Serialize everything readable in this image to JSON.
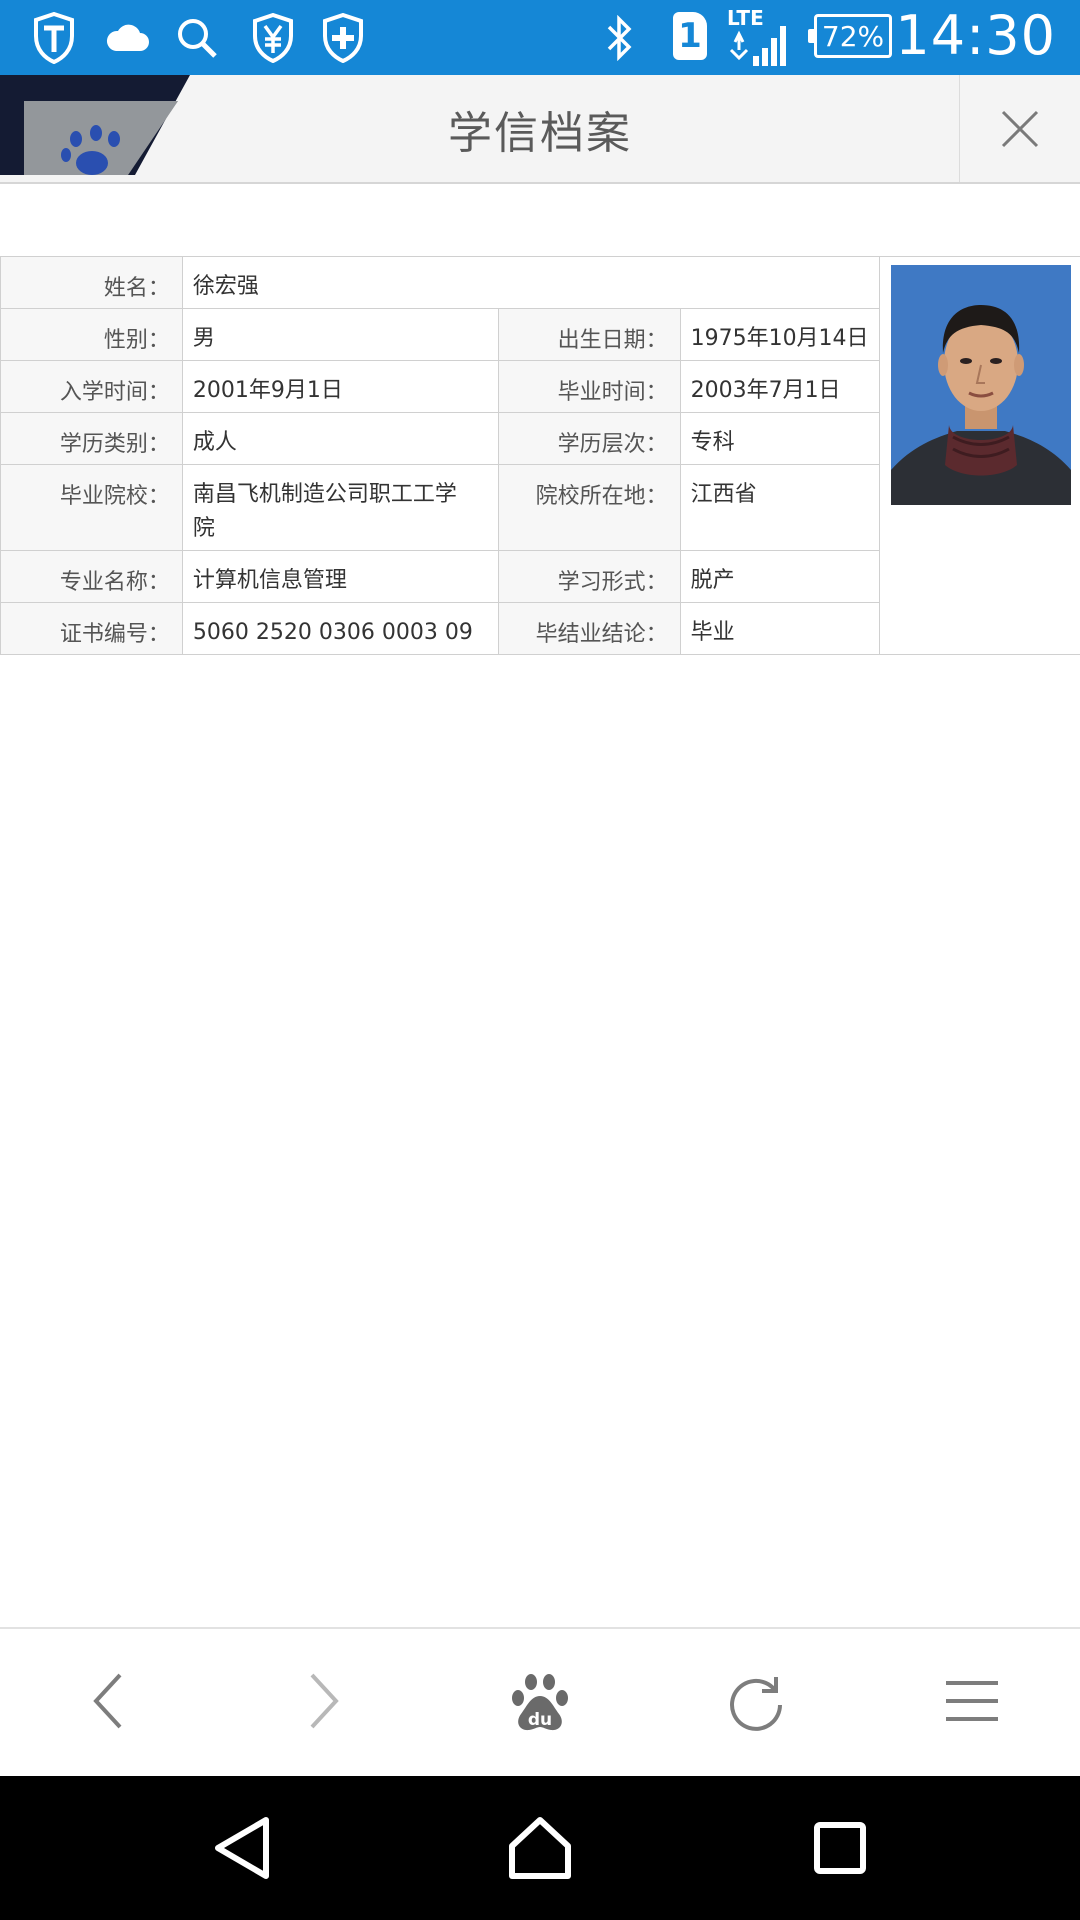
{
  "status_bar": {
    "time": "14:30",
    "battery": "72%",
    "sim": "1",
    "network": "LTE",
    "icons": [
      "shield-t-icon",
      "cloud-icon",
      "search-icon",
      "yuan-shield-icon",
      "plus-shield-icon",
      "bluetooth-icon",
      "sim-icon",
      "signal-icon",
      "battery-icon"
    ]
  },
  "header": {
    "title": "学信档案"
  },
  "record": {
    "labels": {
      "name": "姓名：",
      "gender": "性别：",
      "birth": "出生日期：",
      "enroll": "入学时间：",
      "graduate": "毕业时间：",
      "edu_type": "学历类别：",
      "edu_level": "学历层次：",
      "school": "毕业院校：",
      "school_location": "院校所在地：",
      "major": "专业名称：",
      "study_mode": "学习形式：",
      "cert_no": "证书编号：",
      "conclusion": "毕结业结论："
    },
    "values": {
      "name": "徐宏强",
      "gender": "男",
      "birth": "1975年10月14日",
      "enroll": "2001年9月1日",
      "graduate": "2003年7月1日",
      "edu_type": "成人",
      "edu_level": "专科",
      "school": "南昌飞机制造公司职工工学院",
      "school_location": "江西省",
      "major": "计算机信息管理",
      "study_mode": "脱产",
      "cert_no": "5060 2520 0306 0003 09",
      "conclusion": "毕业"
    }
  },
  "toolbar": {
    "icons": [
      "back-icon",
      "forward-icon",
      "baidu-paw-icon",
      "refresh-icon",
      "menu-icon"
    ],
    "baidu_text": "du"
  },
  "colors": {
    "status_bar": "#1587d6",
    "header_bg": "#f4f4f4",
    "label_bg": "#f7f7f7",
    "photo_bg": "#3f79c4",
    "nav_bar": "#000000"
  }
}
